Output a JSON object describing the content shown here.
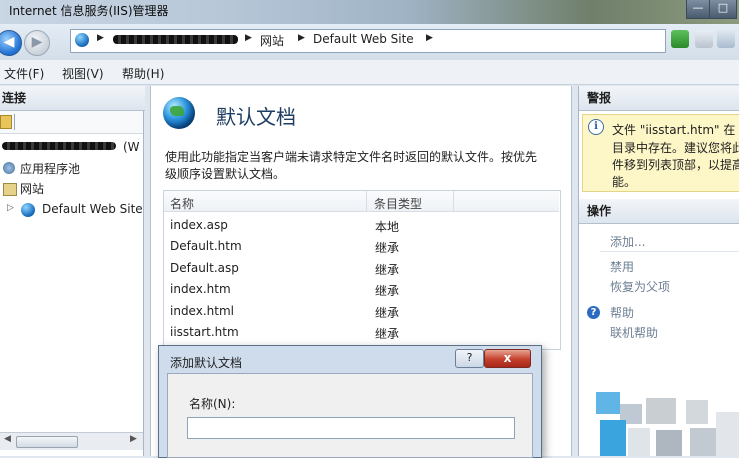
{
  "window": {
    "title": "Internet 信息服务(IIS)管理器",
    "controls": [
      "—",
      "□"
    ]
  },
  "address": {
    "host": "",
    "crumbs": [
      "网站",
      "Default Web Site"
    ]
  },
  "menu": [
    "文件(F)",
    "视图(V)",
    "帮助(H)"
  ],
  "connections": {
    "header": "连接",
    "server_suffix": "(W",
    "items": [
      "应用程序池",
      "网站",
      "Default Web Site"
    ]
  },
  "content": {
    "title": "默认文档",
    "desc_line1": "使用此功能指定当客户端未请求特定文件名时返回的默认文件。按优先",
    "desc_line2": "级顺序设置默认文档。",
    "columns": [
      "名称",
      "条目类型"
    ],
    "rows": [
      {
        "name": "index.asp",
        "type": "本地"
      },
      {
        "name": "Default.htm",
        "type": "继承"
      },
      {
        "name": "Default.asp",
        "type": "继承"
      },
      {
        "name": "index.htm",
        "type": "继承"
      },
      {
        "name": "index.html",
        "type": "继承"
      },
      {
        "name": "iisstart.htm",
        "type": "继承"
      }
    ]
  },
  "alerts": {
    "header": "警报",
    "lines": [
      "文件 \"iisstart.htm\" 在",
      "目录中存在。建议您将此",
      "件移到列表顶部，以提高",
      "能。"
    ]
  },
  "actions": {
    "header": "操作",
    "items": [
      "添加...",
      "禁用",
      "恢复为父项",
      "帮助",
      "联机帮助"
    ]
  },
  "dialog": {
    "title": "添加默认文档",
    "help_button": "?",
    "close_button": "x",
    "name_label": "名称(N):",
    "name_value": ""
  },
  "colors": {
    "accent": "#1e3d62",
    "alert_bg": "#fdf6c7",
    "close": "#c4402c"
  }
}
